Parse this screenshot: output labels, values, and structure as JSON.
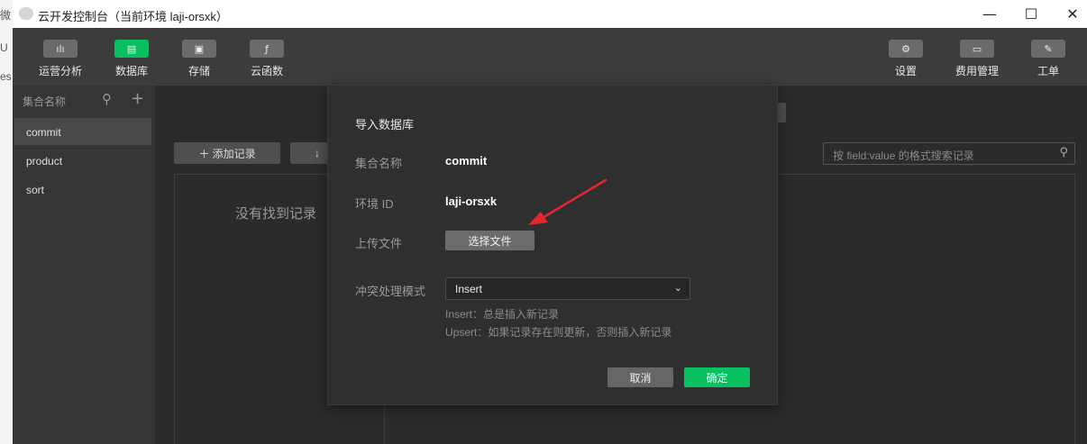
{
  "behind_window": {
    "glyphs": [
      "微",
      "U",
      "es"
    ]
  },
  "window": {
    "title": "云开发控制台（当前环境 laji-orsxk）",
    "controls": {
      "minimize": "—",
      "maximize": "☐",
      "close": "✕"
    }
  },
  "toolbar": {
    "left": [
      {
        "label": "运营分析",
        "icon": "bar-chart-icon",
        "glyph": "ılı",
        "active": false
      },
      {
        "label": "数据库",
        "icon": "database-icon",
        "glyph": "▤",
        "active": true
      },
      {
        "label": "存储",
        "icon": "storage-icon",
        "glyph": "▣",
        "active": false
      },
      {
        "label": "云函数",
        "icon": "cloud-function-icon",
        "glyph": "ƒ",
        "active": false
      }
    ],
    "right": [
      {
        "label": "设置",
        "icon": "gear-icon",
        "glyph": "⚙"
      },
      {
        "label": "费用管理",
        "icon": "billing-icon",
        "glyph": "▭"
      },
      {
        "label": "工单",
        "icon": "ticket-icon",
        "glyph": "✎"
      }
    ]
  },
  "sidebar": {
    "header": "集合名称",
    "search_glyph": "⚲",
    "add_glyph": "+",
    "items": [
      {
        "label": "commit",
        "selected": true
      },
      {
        "label": "product",
        "selected": false
      },
      {
        "label": "sort",
        "selected": false
      }
    ]
  },
  "main": {
    "add_record": "＋ 添加记录",
    "download_glyph": "↓",
    "search_placeholder": "按 field:value 的格式搜索记录",
    "search_glyph": "⚲",
    "empty_text": "没有找到记录"
  },
  "modal": {
    "title": "导入数据库",
    "collection_label": "集合名称",
    "collection_value": "commit",
    "env_label": "环境 ID",
    "env_value": "laji-orsxk",
    "upload_label": "上传文件",
    "choose_file": "选择文件",
    "conflict_label": "冲突处理模式",
    "conflict_value": "Insert",
    "chevron": "⌄",
    "hint_insert": "Insert：总是插入新记录",
    "hint_upsert": "Upsert：如果记录存在则更新，否则插入新记录",
    "cancel": "取消",
    "confirm": "确定"
  },
  "colors": {
    "accent": "#07c160",
    "annotation_arrow": "#e8262e"
  }
}
